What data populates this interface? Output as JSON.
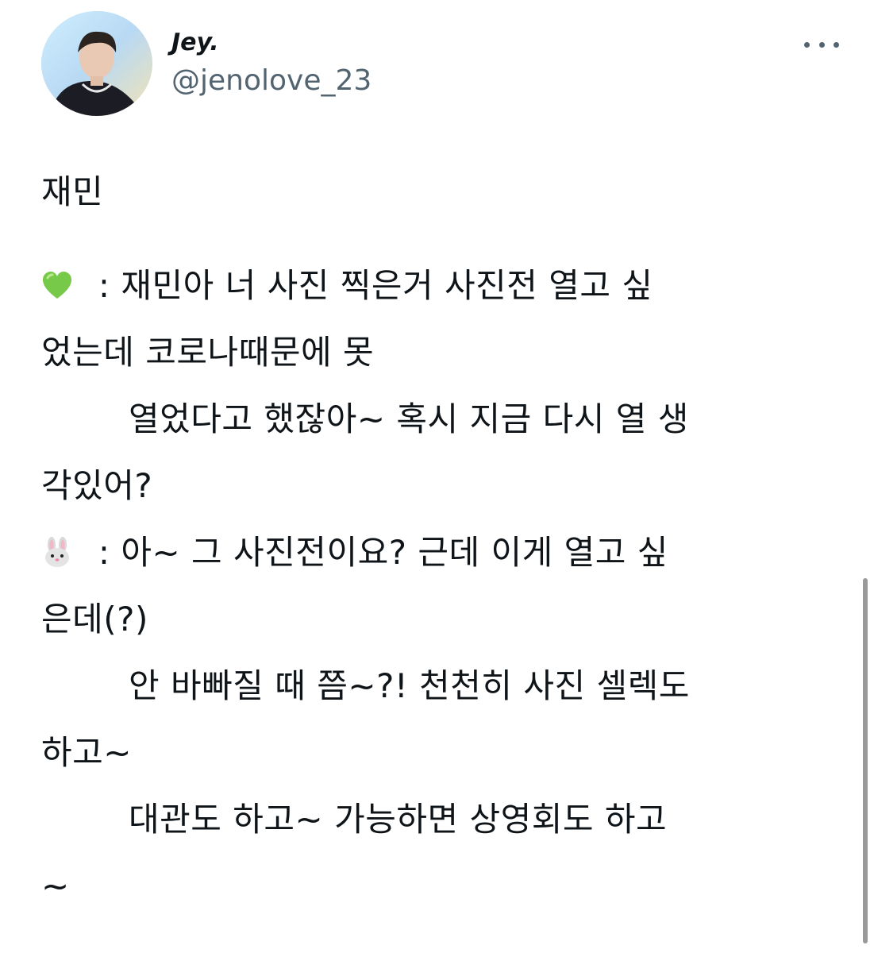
{
  "user": {
    "display_name": "Jey.",
    "handle": "@jenolove_23"
  },
  "header": {
    "more_icon": "more-horizontal-icon"
  },
  "tweet": {
    "lines": [
      "재민",
      " : 재민아 너 사진 찍은거 사진전 열고 싶",
      "었는데 코로나때문에 못",
      "열었다고 했잖아~ 혹시 지금 다시 열 생",
      "각있어?",
      " :  아~ 그 사진전이요? 근데 이게 열고 싶",
      "은데(?)",
      "안 바빠질 때 쯤~?! 천천히 사진 셀렉도",
      "하고~",
      "대관도 하고~ 가능하면 상영회도 하고",
      "~"
    ],
    "speaker_icons": [
      "green-heart-icon",
      "rabbit-face-icon"
    ]
  },
  "colors": {
    "text": "#0f1419",
    "secondary": "#536471",
    "heart": "#77c94a",
    "scrollbar": "#9a9a9a"
  }
}
